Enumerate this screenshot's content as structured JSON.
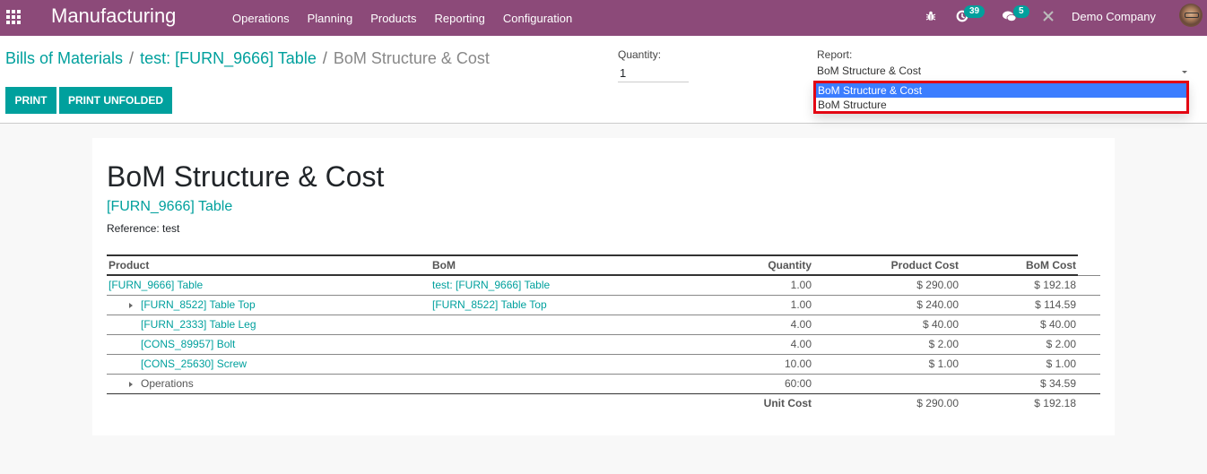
{
  "navbar": {
    "app_title": "Manufacturing",
    "menu": [
      "Operations",
      "Planning",
      "Products",
      "Reporting",
      "Configuration"
    ],
    "activity_count": "39",
    "message_count": "5",
    "company": "Demo Company",
    "brand_color": "#8c4a79",
    "accent_color": "#00a09d"
  },
  "breadcrumb": {
    "items": [
      "Bills of Materials",
      "test: [FURN_9666] Table"
    ],
    "active": "BoM Structure & Cost",
    "separator": "/"
  },
  "buttons": {
    "print": "PRINT",
    "print_unfolded": "PRINT UNFOLDED"
  },
  "quantity": {
    "label": "Quantity:",
    "value": "1"
  },
  "report": {
    "label": "Report:",
    "selected": "BoM Structure & Cost",
    "options": [
      "BoM Structure & Cost",
      "BoM Structure"
    ],
    "highlight_color": "#e30613"
  },
  "sheet": {
    "title": "BoM Structure & Cost",
    "product": "[FURN_9666] Table",
    "reference": "Reference: test",
    "columns": [
      "Product",
      "BoM",
      "Quantity",
      "Product Cost",
      "BoM Cost"
    ],
    "rows": [
      {
        "product": "[FURN_9666] Table",
        "bom": "test: [FURN_9666] Table",
        "quantity": "1.00",
        "product_cost": "$ 290.00",
        "bom_cost": "$ 192.18"
      },
      {
        "product": "[FURN_8522] Table Top",
        "bom": "[FURN_8522] Table Top",
        "quantity": "1.00",
        "product_cost": "$ 240.00",
        "bom_cost": "$ 114.59"
      },
      {
        "product": "[FURN_2333] Table Leg",
        "bom": "",
        "quantity": "4.00",
        "product_cost": "$ 40.00",
        "bom_cost": "$ 40.00"
      },
      {
        "product": "[CONS_89957] Bolt",
        "bom": "",
        "quantity": "4.00",
        "product_cost": "$ 2.00",
        "bom_cost": "$ 2.00"
      },
      {
        "product": "[CONS_25630] Screw",
        "bom": "",
        "quantity": "10.00",
        "product_cost": "$ 1.00",
        "bom_cost": "$ 1.00"
      },
      {
        "product": "Operations",
        "bom": "",
        "quantity": "60:00",
        "product_cost": "",
        "bom_cost": "$ 34.59"
      }
    ],
    "footer": {
      "label": "Unit Cost",
      "product_cost": "$ 290.00",
      "bom_cost": "$ 192.18"
    }
  }
}
